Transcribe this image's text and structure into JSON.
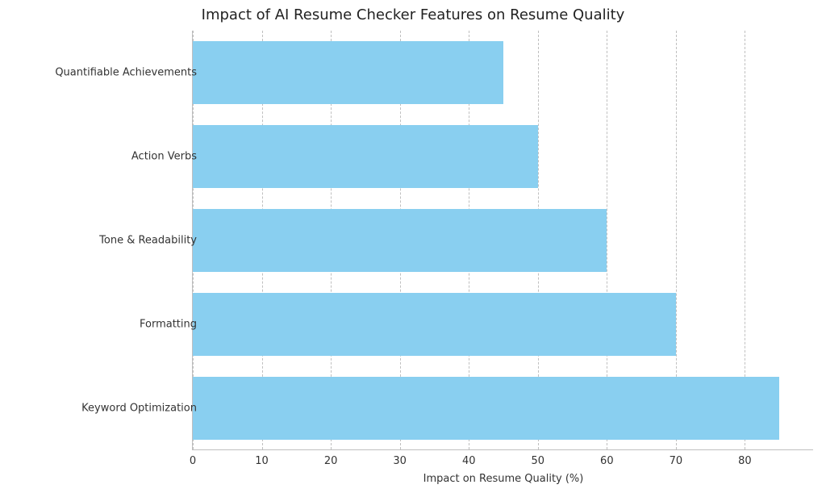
{
  "chart_data": {
    "type": "bar",
    "orientation": "horizontal",
    "title": "Impact of AI Resume Checker Features on Resume Quality",
    "xlabel": "Impact on Resume Quality (%)",
    "ylabel": "",
    "xlim": [
      0,
      90
    ],
    "x_ticks": [
      0,
      10,
      20,
      30,
      40,
      50,
      60,
      70,
      80
    ],
    "categories": [
      "Quantifiable Achievements",
      "Action Verbs",
      "Tone & Readability",
      "Formatting",
      "Keyword Optimization"
    ],
    "values": [
      45,
      50,
      60,
      70,
      85
    ],
    "bar_color": "#89cff0",
    "grid": {
      "axis": "x",
      "style": "dashed"
    }
  }
}
